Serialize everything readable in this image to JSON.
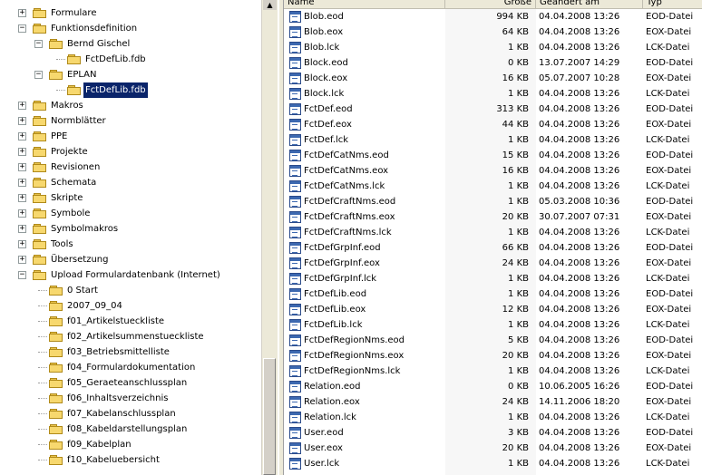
{
  "header": {
    "name": "Name",
    "size": "Größe",
    "modified": "Geändert am",
    "type": "Typ"
  },
  "tree": [
    {
      "label": "Formulare",
      "level": 0,
      "expander": "+"
    },
    {
      "label": "Funktionsdefinition",
      "level": 0,
      "expander": "-"
    },
    {
      "label": "Bernd Gischel",
      "level": 1,
      "expander": "-"
    },
    {
      "label": "FctDefLib.fdb",
      "level": 2,
      "expander": ""
    },
    {
      "label": "EPLAN",
      "level": 1,
      "expander": "-"
    },
    {
      "label": "FctDefLib.fdb",
      "level": 2,
      "expander": "",
      "selected": true
    },
    {
      "label": "Makros",
      "level": 0,
      "expander": "+"
    },
    {
      "label": "Normblätter",
      "level": 0,
      "expander": "+"
    },
    {
      "label": "PPE",
      "level": 0,
      "expander": "+"
    },
    {
      "label": "Projekte",
      "level": 0,
      "expander": "+"
    },
    {
      "label": "Revisionen",
      "level": 0,
      "expander": "+"
    },
    {
      "label": "Schemata",
      "level": 0,
      "expander": "+"
    },
    {
      "label": "Skripte",
      "level": 0,
      "expander": "+"
    },
    {
      "label": "Symbole",
      "level": 0,
      "expander": "+"
    },
    {
      "label": "Symbolmakros",
      "level": 0,
      "expander": "+"
    },
    {
      "label": "Tools",
      "level": 0,
      "expander": "+"
    },
    {
      "label": "Übersetzung",
      "level": 0,
      "expander": "+"
    },
    {
      "label": "Upload Formulardatenbank (Internet)",
      "level": 0,
      "expander": "-"
    },
    {
      "label": "0 Start",
      "level": 1,
      "expander": ""
    },
    {
      "label": "2007_09_04",
      "level": 1,
      "expander": ""
    },
    {
      "label": "f01_Artikelstueckliste",
      "level": 1,
      "expander": ""
    },
    {
      "label": "f02_Artikelsummenstueckliste",
      "level": 1,
      "expander": ""
    },
    {
      "label": "f03_Betriebsmittelliste",
      "level": 1,
      "expander": ""
    },
    {
      "label": "f04_Formulardokumentation",
      "level": 1,
      "expander": ""
    },
    {
      "label": "f05_Geraeteanschlussplan",
      "level": 1,
      "expander": ""
    },
    {
      "label": "f06_Inhaltsverzeichnis",
      "level": 1,
      "expander": ""
    },
    {
      "label": "f07_Kabelanschlussplan",
      "level": 1,
      "expander": ""
    },
    {
      "label": "f08_Kabeldarstellungsplan",
      "level": 1,
      "expander": ""
    },
    {
      "label": "f09_Kabelplan",
      "level": 1,
      "expander": ""
    },
    {
      "label": "f10_Kabeluebersicht",
      "level": 1,
      "expander": ""
    }
  ],
  "files": [
    {
      "name": "Blob.eod",
      "size": "994 KB",
      "date": "04.04.2008 13:26",
      "type": "EOD-Datei"
    },
    {
      "name": "Blob.eox",
      "size": "64 KB",
      "date": "04.04.2008 13:26",
      "type": "EOX-Datei"
    },
    {
      "name": "Blob.lck",
      "size": "1 KB",
      "date": "04.04.2008 13:26",
      "type": "LCK-Datei"
    },
    {
      "name": "Block.eod",
      "size": "0 KB",
      "date": "13.07.2007 14:29",
      "type": "EOD-Datei"
    },
    {
      "name": "Block.eox",
      "size": "16 KB",
      "date": "05.07.2007 10:28",
      "type": "EOX-Datei"
    },
    {
      "name": "Block.lck",
      "size": "1 KB",
      "date": "04.04.2008 13:26",
      "type": "LCK-Datei"
    },
    {
      "name": "FctDef.eod",
      "size": "313 KB",
      "date": "04.04.2008 13:26",
      "type": "EOD-Datei"
    },
    {
      "name": "FctDef.eox",
      "size": "44 KB",
      "date": "04.04.2008 13:26",
      "type": "EOX-Datei"
    },
    {
      "name": "FctDef.lck",
      "size": "1 KB",
      "date": "04.04.2008 13:26",
      "type": "LCK-Datei"
    },
    {
      "name": "FctDefCatNms.eod",
      "size": "15 KB",
      "date": "04.04.2008 13:26",
      "type": "EOD-Datei"
    },
    {
      "name": "FctDefCatNms.eox",
      "size": "16 KB",
      "date": "04.04.2008 13:26",
      "type": "EOX-Datei"
    },
    {
      "name": "FctDefCatNms.lck",
      "size": "1 KB",
      "date": "04.04.2008 13:26",
      "type": "LCK-Datei"
    },
    {
      "name": "FctDefCraftNms.eod",
      "size": "1 KB",
      "date": "05.03.2008 10:36",
      "type": "EOD-Datei"
    },
    {
      "name": "FctDefCraftNms.eox",
      "size": "20 KB",
      "date": "30.07.2007 07:31",
      "type": "EOX-Datei"
    },
    {
      "name": "FctDefCraftNms.lck",
      "size": "1 KB",
      "date": "04.04.2008 13:26",
      "type": "LCK-Datei"
    },
    {
      "name": "FctDefGrpInf.eod",
      "size": "66 KB",
      "date": "04.04.2008 13:26",
      "type": "EOD-Datei"
    },
    {
      "name": "FctDefGrpInf.eox",
      "size": "24 KB",
      "date": "04.04.2008 13:26",
      "type": "EOX-Datei"
    },
    {
      "name": "FctDefGrpInf.lck",
      "size": "1 KB",
      "date": "04.04.2008 13:26",
      "type": "LCK-Datei"
    },
    {
      "name": "FctDefLib.eod",
      "size": "1 KB",
      "date": "04.04.2008 13:26",
      "type": "EOD-Datei"
    },
    {
      "name": "FctDefLib.eox",
      "size": "12 KB",
      "date": "04.04.2008 13:26",
      "type": "EOX-Datei"
    },
    {
      "name": "FctDefLib.lck",
      "size": "1 KB",
      "date": "04.04.2008 13:26",
      "type": "LCK-Datei"
    },
    {
      "name": "FctDefRegionNms.eod",
      "size": "5 KB",
      "date": "04.04.2008 13:26",
      "type": "EOD-Datei"
    },
    {
      "name": "FctDefRegionNms.eox",
      "size": "20 KB",
      "date": "04.04.2008 13:26",
      "type": "EOX-Datei"
    },
    {
      "name": "FctDefRegionNms.lck",
      "size": "1 KB",
      "date": "04.04.2008 13:26",
      "type": "LCK-Datei"
    },
    {
      "name": "Relation.eod",
      "size": "0 KB",
      "date": "10.06.2005 16:26",
      "type": "EOD-Datei"
    },
    {
      "name": "Relation.eox",
      "size": "24 KB",
      "date": "14.11.2006 18:20",
      "type": "EOX-Datei"
    },
    {
      "name": "Relation.lck",
      "size": "1 KB",
      "date": "04.04.2008 13:26",
      "type": "LCK-Datei"
    },
    {
      "name": "User.eod",
      "size": "3 KB",
      "date": "04.04.2008 13:26",
      "type": "EOD-Datei"
    },
    {
      "name": "User.eox",
      "size": "20 KB",
      "date": "04.04.2008 13:26",
      "type": "EOX-Datei"
    },
    {
      "name": "User.lck",
      "size": "1 KB",
      "date": "04.04.2008 13:26",
      "type": "LCK-Datei"
    }
  ],
  "icons": {
    "folder": "folder-icon",
    "file": "file-icon",
    "scroll_up": "scroll-up-arrow-icon"
  },
  "colors": {
    "selection": "#0a246a",
    "folder": "#f7d86e",
    "chrome": "#ece9d8"
  }
}
